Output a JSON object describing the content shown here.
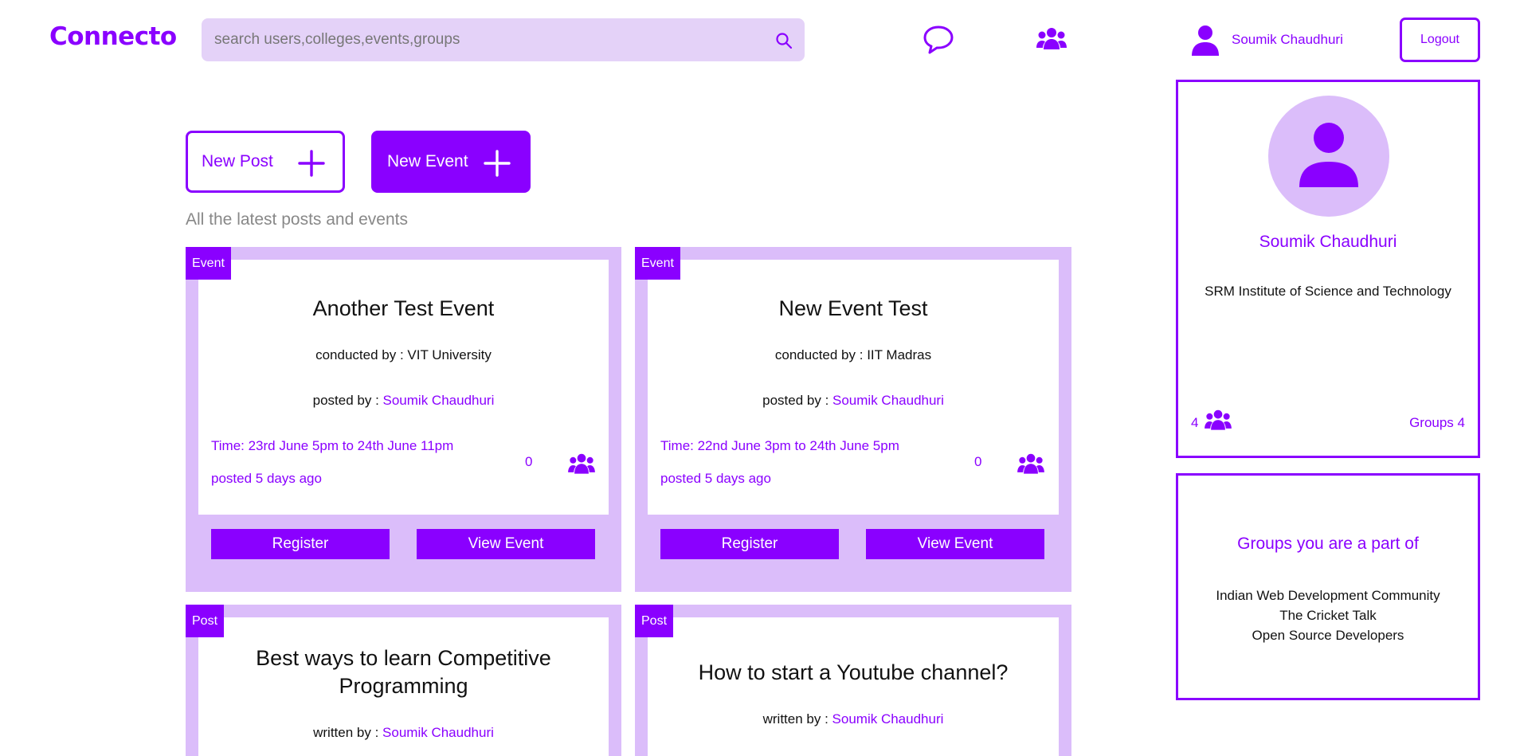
{
  "header": {
    "logo": "Connecto",
    "search_placeholder": "search users,colleges,events,groups",
    "user_name": "Soumik Chaudhuri",
    "logout_label": "Logout"
  },
  "actions": {
    "new_post_label": "New Post",
    "new_event_label": "New Event"
  },
  "feed": {
    "subtitle": "All the latest posts and events",
    "items": [
      {
        "tag": "Event",
        "title": "Another Test Event",
        "conducted_prefix": "conducted by : ",
        "conducted_by": "VIT University",
        "posted_prefix": "posted by : ",
        "posted_by": "Soumik Chaudhuri",
        "time": "Time: 23rd June 5pm to 24th June 11pm",
        "posted_ago": "posted 5 days ago",
        "count": "0",
        "register_label": "Register",
        "view_label": "View Event"
      },
      {
        "tag": "Event",
        "title": "New Event Test",
        "conducted_prefix": "conducted by : ",
        "conducted_by": "IIT Madras",
        "posted_prefix": "posted by : ",
        "posted_by": "Soumik Chaudhuri",
        "time": "Time: 22nd June 3pm to 24th June 5pm",
        "posted_ago": "posted 5 days ago",
        "count": "0",
        "register_label": "Register",
        "view_label": "View Event"
      },
      {
        "tag": "Post",
        "title_line1": "Best ways to learn Competitive",
        "title_line2": "Programming",
        "written_prefix": "written by : ",
        "written_by": "Soumik Chaudhuri"
      },
      {
        "tag": "Post",
        "title": "How to start a Youtube channel?",
        "written_prefix": "written by : ",
        "written_by": "Soumik Chaudhuri"
      }
    ]
  },
  "profile": {
    "name": "Soumik Chaudhuri",
    "college": "SRM Institute of Science and Technology",
    "friends_count": "4",
    "groups_label": "Groups 4"
  },
  "groups": {
    "title": "Groups you are a part of",
    "items": [
      "Indian Web Development Community",
      "The Cricket Talk",
      "Open Source Developers"
    ]
  },
  "colors": {
    "accent": "#8a00ff",
    "card_bg": "#dbbdfa",
    "search_bg": "#e4d2f8"
  }
}
